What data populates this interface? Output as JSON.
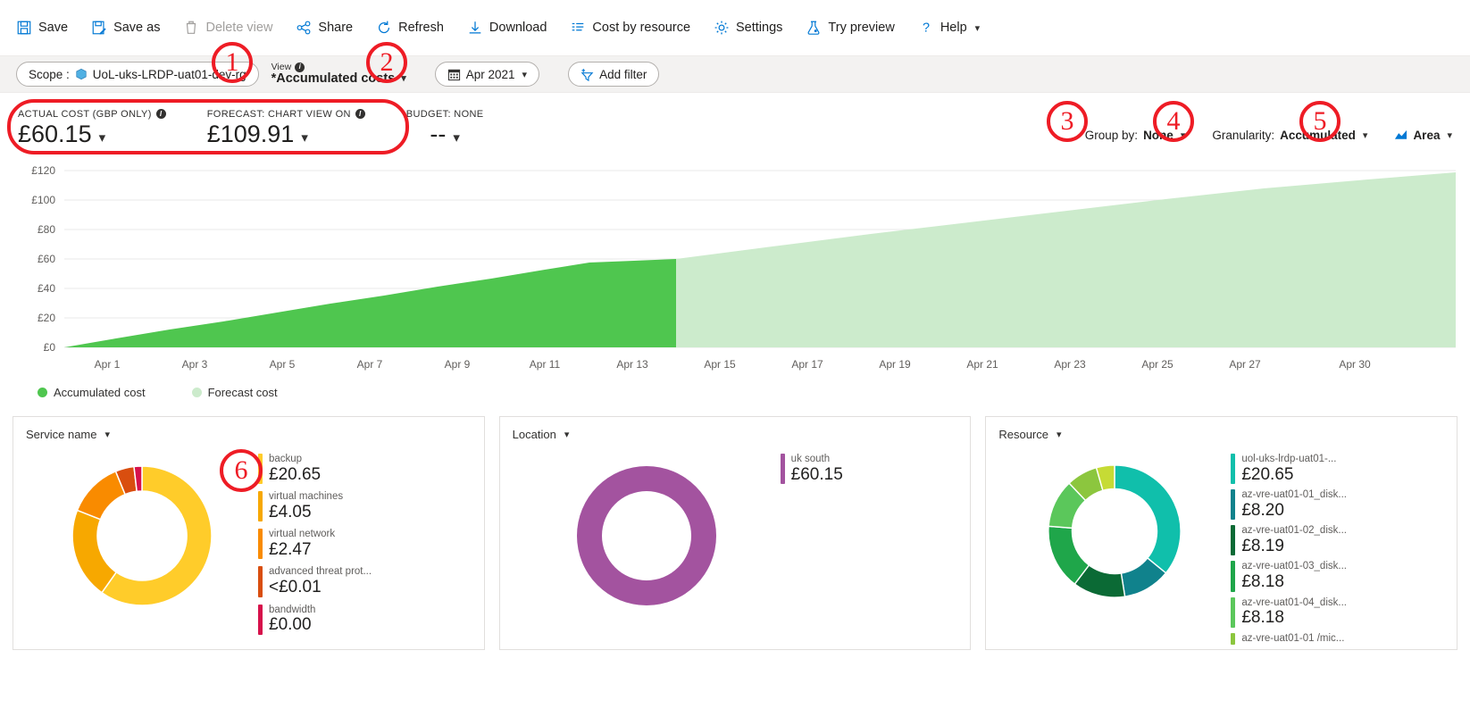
{
  "toolbar": {
    "items": [
      {
        "label": "Save",
        "icon": "save-icon",
        "disabled": false
      },
      {
        "label": "Save as",
        "icon": "save-as-icon",
        "disabled": false
      },
      {
        "label": "Delete view",
        "icon": "trash-icon",
        "disabled": true
      },
      {
        "label": "Share",
        "icon": "share-icon",
        "disabled": false
      },
      {
        "label": "Refresh",
        "icon": "refresh-icon",
        "disabled": false
      },
      {
        "label": "Download",
        "icon": "download-icon",
        "disabled": false
      },
      {
        "label": "Cost by resource",
        "icon": "list-icon",
        "disabled": false
      },
      {
        "label": "Settings",
        "icon": "gear-icon",
        "disabled": false
      },
      {
        "label": "Try preview",
        "icon": "beaker-icon",
        "disabled": false
      },
      {
        "label": "Help",
        "icon": "question-icon",
        "disabled": false,
        "chevron": true
      }
    ]
  },
  "scopebar": {
    "scope_prefix": "Scope :",
    "scope_value": "UoL-uks-LRDP-uat01-dev-rg",
    "view_label": "View",
    "view_value": "*Accumulated costs",
    "date_value": "Apr 2021",
    "add_filter": "Add filter"
  },
  "summary": {
    "kpis": [
      {
        "label": "ACTUAL COST (GBP ONLY)",
        "value": "£60.15",
        "info": true
      },
      {
        "label": "FORECAST: CHART VIEW ON",
        "value": "£109.91",
        "info": true
      },
      {
        "label": "BUDGET: NONE",
        "value": "--",
        "info": false
      }
    ],
    "controls": [
      {
        "prefix": "Group by:",
        "value": "None"
      },
      {
        "prefix": "Granularity:",
        "value": "Accumulated"
      },
      {
        "prefix": "",
        "value": "Area",
        "icon": "chart-type-icon"
      }
    ]
  },
  "chart_data": {
    "type": "area",
    "title": "",
    "xlabel": "",
    "ylabel": "",
    "ylim": [
      0,
      120
    ],
    "yticks": [
      "£0",
      "£20",
      "£40",
      "£60",
      "£80",
      "£100",
      "£120"
    ],
    "ytick_values": [
      0,
      20,
      40,
      60,
      80,
      100,
      120
    ],
    "xticks": [
      "Apr 1",
      "Apr 3",
      "Apr 5",
      "Apr 7",
      "Apr 9",
      "Apr 11",
      "Apr 13",
      "Apr 15",
      "Apr 17",
      "Apr 19",
      "Apr 21",
      "Apr 23",
      "Apr 25",
      "Apr 27",
      "Apr 30"
    ],
    "grid": true,
    "legend_position": "bottom-left",
    "series": [
      {
        "name": "Accumulated cost",
        "color": "#4FC64F",
        "x": [
          "Apr 1",
          "Apr 2",
          "Apr 3",
          "Apr 4",
          "Apr 5",
          "Apr 6",
          "Apr 7",
          "Apr 8",
          "Apr 9",
          "Apr 10",
          "Apr 11",
          "Apr 12",
          "Apr 13",
          "Apr 14"
        ],
        "values": [
          1.5,
          5.8,
          10.0,
          14.2,
          18.4,
          22.6,
          26.8,
          31.0,
          35.2,
          39.4,
          43.6,
          48.0,
          54.5,
          60.15
        ]
      },
      {
        "name": "Forecast cost",
        "color": "#CCEBCC",
        "x": [
          "Apr 14",
          "Apr 16",
          "Apr 18",
          "Apr 20",
          "Apr 22",
          "Apr 24",
          "Apr 26",
          "Apr 28",
          "Apr 30"
        ],
        "values": [
          60.15,
          67.0,
          74.0,
          80.5,
          87.0,
          93.5,
          99.0,
          104.5,
          109.91
        ]
      }
    ]
  },
  "cards": [
    {
      "title": "Service name",
      "donut_type": "donut",
      "slices": [
        {
          "name": "backup",
          "value": "£20.65",
          "amount": 20.65,
          "color": "#FFCC2A"
        },
        {
          "name": "virtual machines",
          "value": "£4.05",
          "amount": 4.05,
          "color": "#F7A800"
        },
        {
          "name": "virtual network",
          "value": "£2.47",
          "amount": 2.47,
          "color": "#F98B00"
        },
        {
          "name": "advanced threat prot...",
          "value": "<£0.01",
          "amount": 0.01,
          "color": "#D94E0F"
        },
        {
          "name": "bandwidth",
          "value": "£0.00",
          "amount": 0.0,
          "color": "#D6114B"
        }
      ]
    },
    {
      "title": "Location",
      "donut_type": "donut",
      "slices": [
        {
          "name": "uk south",
          "value": "£60.15",
          "amount": 60.15,
          "color": "#A3539F"
        }
      ]
    },
    {
      "title": "Resource",
      "donut_type": "donut",
      "slices": [
        {
          "name": "uol-uks-lrdp-uat01-...",
          "value": "£20.65",
          "amount": 20.65,
          "color": "#10BFAB"
        },
        {
          "name": "az-vre-uat01-01_disk...",
          "value": "£8.20",
          "amount": 8.2,
          "color": "#10828C"
        },
        {
          "name": "az-vre-uat01-02_disk...",
          "value": "£8.19",
          "amount": 8.19,
          "color": "#0B6A35"
        },
        {
          "name": "az-vre-uat01-03_disk...",
          "value": "£8.18",
          "amount": 8.18,
          "color": "#1FA64A"
        },
        {
          "name": "az-vre-uat01-04_disk...",
          "value": "£8.18",
          "amount": 8.18,
          "color": "#5BC75B"
        },
        {
          "name": "az-vre-uat01-01 /mic...",
          "value": "",
          "amount": 6.0,
          "color": "#8CC63E"
        }
      ]
    }
  ],
  "annotations": [
    {
      "number": "1"
    },
    {
      "number": "2"
    },
    {
      "number": "3"
    },
    {
      "number": "4"
    },
    {
      "number": "5"
    },
    {
      "number": "6"
    }
  ],
  "colors": {
    "accent": "#0078D4",
    "actual": "#4FC64F",
    "forecast": "#CCEBCC",
    "annotation": "#EE1C25"
  }
}
